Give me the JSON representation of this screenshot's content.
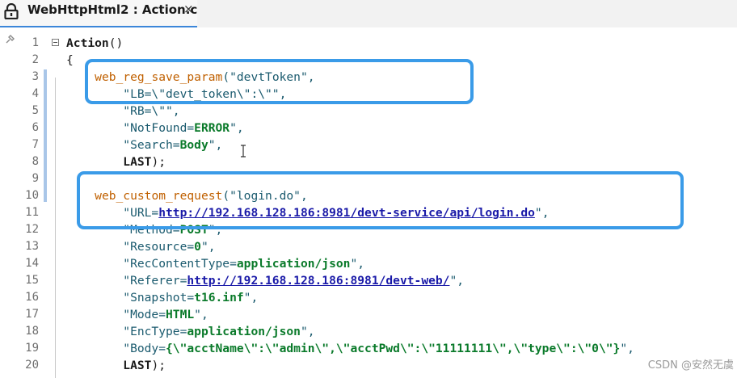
{
  "tab": {
    "title": "WebHttpHtml2 : Action.c",
    "close": "×",
    "lock_icon": "lock-icon"
  },
  "editor": {
    "gutter_icon": "pin-icon",
    "lines": [
      {
        "n": "1",
        "segs": [
          {
            "t": "Action",
            "c": "pl bold"
          },
          {
            "t": "()",
            "c": "pl"
          }
        ]
      },
      {
        "n": "2",
        "segs": [
          {
            "t": "{",
            "c": "pl"
          }
        ]
      },
      {
        "n": "3",
        "segs": [
          {
            "t": "    ",
            "c": "pl"
          },
          {
            "t": "web_reg_save_param",
            "c": "fn"
          },
          {
            "t": "(\"devtToken\",",
            "c": "str"
          }
        ]
      },
      {
        "n": "4",
        "segs": [
          {
            "t": "        \"LB=\\\"devt_token\\\":\\\"\",",
            "c": "str"
          }
        ]
      },
      {
        "n": "5",
        "segs": [
          {
            "t": "        \"RB=\\\"\",",
            "c": "str"
          }
        ]
      },
      {
        "n": "6",
        "segs": [
          {
            "t": "        \"NotFound=",
            "c": "str"
          },
          {
            "t": "ERROR",
            "c": "kw"
          },
          {
            "t": "\",",
            "c": "str"
          }
        ]
      },
      {
        "n": "7",
        "segs": [
          {
            "t": "        \"Search=",
            "c": "str"
          },
          {
            "t": "Body",
            "c": "kw"
          },
          {
            "t": "\",",
            "c": "str"
          }
        ]
      },
      {
        "n": "8",
        "segs": [
          {
            "t": "        ",
            "c": "pl"
          },
          {
            "t": "LAST",
            "c": "pl bold"
          },
          {
            "t": ");",
            "c": "pl"
          }
        ]
      },
      {
        "n": "9",
        "segs": []
      },
      {
        "n": "10",
        "segs": [
          {
            "t": "    ",
            "c": "pl"
          },
          {
            "t": "web_custom_request",
            "c": "fn"
          },
          {
            "t": "(\"login.do\",",
            "c": "str"
          }
        ]
      },
      {
        "n": "11",
        "segs": [
          {
            "t": "        \"URL=",
            "c": "str"
          },
          {
            "t": "http://192.168.128.186:8981/devt-service/api/login.do",
            "c": "url"
          },
          {
            "t": "\",",
            "c": "str"
          }
        ]
      },
      {
        "n": "12",
        "segs": [
          {
            "t": "        \"Method=",
            "c": "str"
          },
          {
            "t": "POST",
            "c": "kw"
          },
          {
            "t": "\",",
            "c": "str"
          }
        ]
      },
      {
        "n": "13",
        "segs": [
          {
            "t": "        \"Resource=",
            "c": "str"
          },
          {
            "t": "0",
            "c": "kw"
          },
          {
            "t": "\",",
            "c": "str"
          }
        ]
      },
      {
        "n": "14",
        "segs": [
          {
            "t": "        \"RecContentType=",
            "c": "str"
          },
          {
            "t": "application/json",
            "c": "kw"
          },
          {
            "t": "\",",
            "c": "str"
          }
        ]
      },
      {
        "n": "15",
        "segs": [
          {
            "t": "        \"Referer=",
            "c": "str"
          },
          {
            "t": "http://192.168.128.186:8981/devt-web/",
            "c": "url"
          },
          {
            "t": "\",",
            "c": "str"
          }
        ]
      },
      {
        "n": "16",
        "segs": [
          {
            "t": "        \"Snapshot=",
            "c": "str"
          },
          {
            "t": "t16.inf",
            "c": "kw"
          },
          {
            "t": "\",",
            "c": "str"
          }
        ]
      },
      {
        "n": "17",
        "segs": [
          {
            "t": "        \"Mode=",
            "c": "str"
          },
          {
            "t": "HTML",
            "c": "kw"
          },
          {
            "t": "\",",
            "c": "str"
          }
        ]
      },
      {
        "n": "18",
        "segs": [
          {
            "t": "        \"EncType=",
            "c": "str"
          },
          {
            "t": "application/json",
            "c": "kw"
          },
          {
            "t": "\",",
            "c": "str"
          }
        ]
      },
      {
        "n": "19",
        "segs": [
          {
            "t": "        \"Body=",
            "c": "str"
          },
          {
            "t": "{\\\"acctName\\\":\\\"admin\\\",\\\"acctPwd\\\":\\\"11111111\\\",\\\"type\\\":\\\"0\\\"}",
            "c": "kw"
          },
          {
            "t": "\",",
            "c": "str"
          }
        ]
      },
      {
        "n": "20",
        "segs": [
          {
            "t": "        ",
            "c": "pl"
          },
          {
            "t": "LAST",
            "c": "pl bold"
          },
          {
            "t": ");",
            "c": "pl"
          }
        ]
      }
    ]
  },
  "watermark": "CSDN @安然无虞",
  "colors": {
    "accent": "#3a9be8",
    "function": "#c06000",
    "string": "#1a5a6e",
    "keyword": "#0a7a2a",
    "url": "#1a1aa8"
  }
}
